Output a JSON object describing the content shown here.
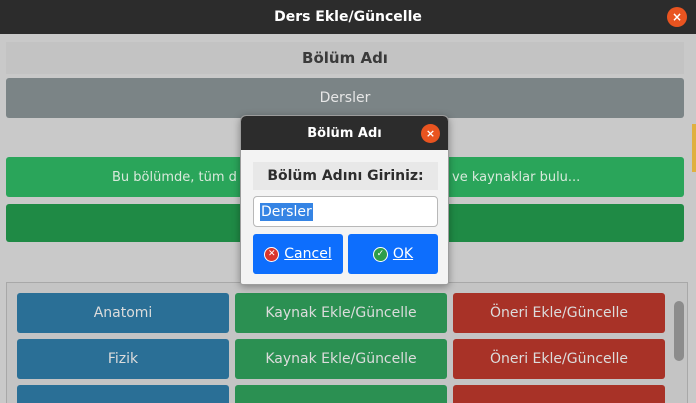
{
  "window": {
    "title": "Ders Ekle/Güncelle",
    "close_glyph": "×"
  },
  "main": {
    "section_title": "Bölüm Adı",
    "section_name_button": "Dersler",
    "description_left": "Bu bölümde, tüm d",
    "description_right": "ve kaynaklar bulu..."
  },
  "courses": [
    {
      "name": "Anatomi",
      "resource_button": "Kaynak Ekle/Güncelle",
      "suggestion_button": "Öneri Ekle/Güncelle"
    },
    {
      "name": "Fizik",
      "resource_button": "Kaynak Ekle/Güncelle",
      "suggestion_button": "Öneri Ekle/Güncelle"
    }
  ],
  "dialog": {
    "title": "Bölüm Adı",
    "close_glyph": "×",
    "prompt": "Bölüm Adını Giriniz:",
    "input_value": "Dersler",
    "cancel_label": "Cancel",
    "ok_label": "OK",
    "cancel_icon": "cancel-icon",
    "ok_icon": "ok-icon"
  },
  "colors": {
    "accent_orange": "#e95420",
    "blue": "#2a6f96",
    "green": "#2b9052",
    "red": "#a83227",
    "dialog_button": "#0d6efd"
  }
}
